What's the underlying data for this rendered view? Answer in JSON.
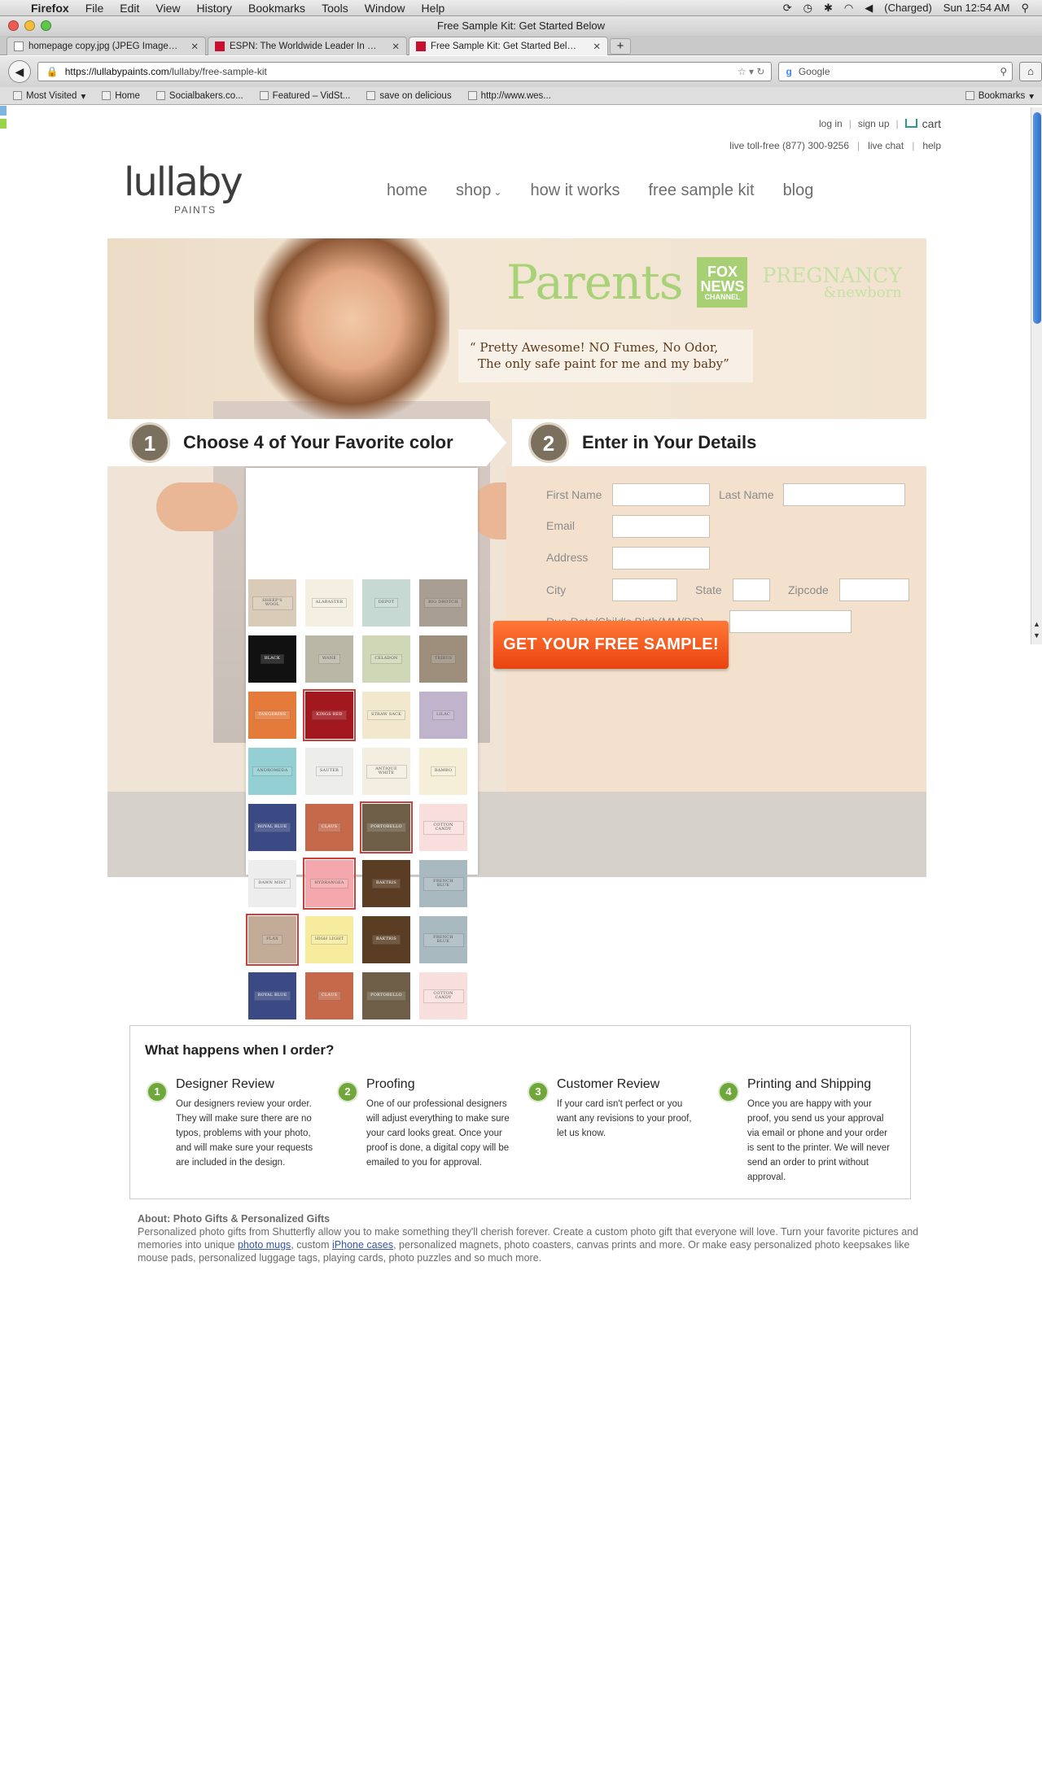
{
  "os_menu": {
    "app": "Firefox",
    "items": [
      "File",
      "Edit",
      "View",
      "History",
      "Bookmarks",
      "Tools",
      "Window",
      "Help"
    ],
    "battery": "(Charged)",
    "clock": "Sun 12:54 AM"
  },
  "window": {
    "title": "Free Sample Kit: Get Started Below"
  },
  "tabs": [
    {
      "label": "homepage copy.jpg (JPEG Image…"
    },
    {
      "label": "ESPN: The Worldwide Leader In …"
    },
    {
      "label": "Free Sample Kit: Get Started Bel…"
    }
  ],
  "navbar": {
    "url_host": "https://lullabypaints.com",
    "url_path": "/lullaby/free-sample-kit",
    "search_engine": "Google"
  },
  "bookmarks": [
    "Most Visited",
    "Home",
    "Socialbakers.co...",
    "Featured – VidSt...",
    "save on delicious",
    "http://www.wes...",
    "Bookmarks"
  ],
  "header": {
    "login": "log in",
    "signup": "sign up",
    "cart": "cart",
    "tollfree": "live toll-free (877) 300-9256",
    "livechat": "live chat",
    "help": "help",
    "logo_word": "lullaby",
    "logo_sub": "PAINTS",
    "nav": [
      "home",
      "shop",
      "how it works",
      "free sample kit",
      "blog"
    ]
  },
  "hero": {
    "press_parents": "Parents",
    "press_fox_1": "FOX",
    "press_fox_2": "NEWS",
    "press_fox_3": "CHANNEL",
    "press_preg_1": "PREGNANCY",
    "press_preg_2": "&newborn",
    "quote_1": "“ Pretty Awesome! NO Fumes, No Odor,",
    "quote_2": "The only safe paint for me and my baby”",
    "step1_num": "1",
    "step1_label": "Choose 4 of Your Favorite color",
    "step2_num": "2",
    "step2_label": "Enter in Your Details"
  },
  "swatches": [
    {
      "name": "SHEEP'S WOOL",
      "color": "#d9cbb7",
      "sel": false
    },
    {
      "name": "ALABASTER",
      "color": "#f4efe0",
      "sel": false
    },
    {
      "name": "DEPOT",
      "color": "#c6d9d2",
      "sel": false
    },
    {
      "name": "BIG DROTCH",
      "color": "#a89f92",
      "sel": false
    },
    {
      "name": "BLACK",
      "color": "#111111",
      "sel": false
    },
    {
      "name": "WANE",
      "color": "#b9b8a6",
      "sel": false
    },
    {
      "name": "CELADON",
      "color": "#cfd7b6",
      "sel": false
    },
    {
      "name": "TRIBUS",
      "color": "#9d8f7c",
      "sel": false
    },
    {
      "name": "TANGERINE",
      "color": "#e57b3a",
      "sel": false
    },
    {
      "name": "KINGS RED",
      "color": "#a3171e",
      "sel": true
    },
    {
      "name": "STRAW SACK",
      "color": "#f1e8cd",
      "sel": false
    },
    {
      "name": "LILAC",
      "color": "#bfb4cc",
      "sel": false
    },
    {
      "name": "ANDROMEDA",
      "color": "#93cfd3",
      "sel": false
    },
    {
      "name": "SAUTER",
      "color": "#ededeb",
      "sel": false
    },
    {
      "name": "ANTIQUE WHITE",
      "color": "#f3eee0",
      "sel": false
    },
    {
      "name": "BAMBO",
      "color": "#f4efd6",
      "sel": false
    },
    {
      "name": "ROYAL BLUE",
      "color": "#3b4a85",
      "sel": false
    },
    {
      "name": "CLAUS",
      "color": "#c5694a",
      "sel": false
    },
    {
      "name": "PORTOBELLO",
      "color": "#6e5e47",
      "sel": true
    },
    {
      "name": "COTTON CANDY",
      "color": "#f9dede",
      "sel": false
    },
    {
      "name": "DAWN MIST",
      "color": "#ededed",
      "sel": false
    },
    {
      "name": "HYDRANGEA",
      "color": "#f4a8ad",
      "sel": true
    },
    {
      "name": "BAKTRIS",
      "color": "#5a3d23",
      "sel": false
    },
    {
      "name": "FRENCH BLUE",
      "color": "#a8b9c0",
      "sel": false
    },
    {
      "name": "FLAX",
      "color": "#c2ac97",
      "sel": true
    },
    {
      "name": "HIGH LIGHT",
      "color": "#f7ec9e",
      "sel": false
    },
    {
      "name": "BAKTRIS",
      "color": "#5a3d23",
      "sel": false
    },
    {
      "name": "FRENCH BLUE",
      "color": "#a8b9c0",
      "sel": false
    },
    {
      "name": "ROYAL BLUE",
      "color": "#3b4a85",
      "sel": false
    },
    {
      "name": "CLAUS",
      "color": "#c5694a",
      "sel": false
    },
    {
      "name": "PORTOBELLO",
      "color": "#6e5e47",
      "sel": false
    },
    {
      "name": "COTTON CANDY",
      "color": "#f9dede",
      "sel": false
    }
  ],
  "form": {
    "first_name": "First Name",
    "last_name": "Last Name",
    "email": "Email",
    "address": "Address",
    "city": "City",
    "state": "State",
    "zipcode": "Zipcode",
    "due_date": "Due Date/Child's Birth(MM/DD)",
    "submit": "GET YOUR FREE SAMPLE!"
  },
  "order": {
    "title": "What happens when I order?",
    "steps": [
      {
        "num": "1",
        "title": "Designer Review",
        "text": "Our designers review your order. They will make sure there are no typos, problems with your photo, and will make sure your requests are included in the design."
      },
      {
        "num": "2",
        "title": "Proofing",
        "text": "One of our professional designers will adjust everything to make sure your card looks great. Once your proof is done, a digital copy will be emailed to you for approval."
      },
      {
        "num": "3",
        "title": "Customer Review",
        "text": "If your card isn't perfect or you want any revisions to your proof, let us know."
      },
      {
        "num": "4",
        "title": "Printing and Shipping",
        "text": "Once you are happy with your proof, you send us your approval via email or phone and your order is sent to the printer. We will never send an order to print without approval."
      }
    ]
  },
  "about": {
    "heading": "About: Photo Gifts & Personalized Gifts",
    "text_1": "Personalized photo gifts from Shutterfly allow you to make something they'll cherish forever. Create a custom photo gift that everyone will love. Turn your favorite pictures and memories into unique ",
    "link_1": "photo mugs",
    "text_2": ", custom ",
    "link_2": "iPhone cases",
    "text_3": ", personalized magnets, photo coasters, canvas prints and more. Or make easy personalized photo keepsakes like mouse pads, personalized luggage tags, playing cards, photo puzzles and so much more."
  }
}
